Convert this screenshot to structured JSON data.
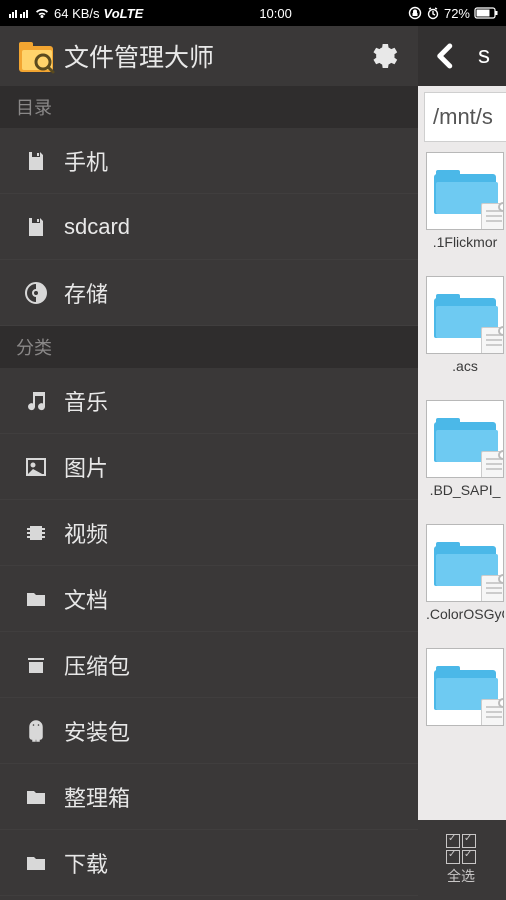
{
  "status": {
    "signal_text": "64 KB/s",
    "volte": "VoLTE",
    "time": "10:00",
    "battery_pct": "72%"
  },
  "drawer": {
    "app_title": "文件管理大师",
    "sections": {
      "dir_header": "目录",
      "cat_header": "分类"
    },
    "dir_items": [
      {
        "label": "手机"
      },
      {
        "label": "sdcard"
      },
      {
        "label": "存储"
      }
    ],
    "cat_items": [
      {
        "label": "音乐"
      },
      {
        "label": "图片"
      },
      {
        "label": "视频"
      },
      {
        "label": "文档"
      },
      {
        "label": "压缩包"
      },
      {
        "label": "安装包"
      },
      {
        "label": "整理箱"
      },
      {
        "label": "下载"
      }
    ]
  },
  "content": {
    "toolbar_title": "s",
    "path": "/mnt/s",
    "folders": [
      {
        "name": ".1Flickmor"
      },
      {
        "name": ".acs"
      },
      {
        "name": ".BD_SAPI_"
      },
      {
        "name": ".ColorOSGyOclou"
      },
      {
        "name": ""
      }
    ],
    "select_all_label": "全选"
  }
}
